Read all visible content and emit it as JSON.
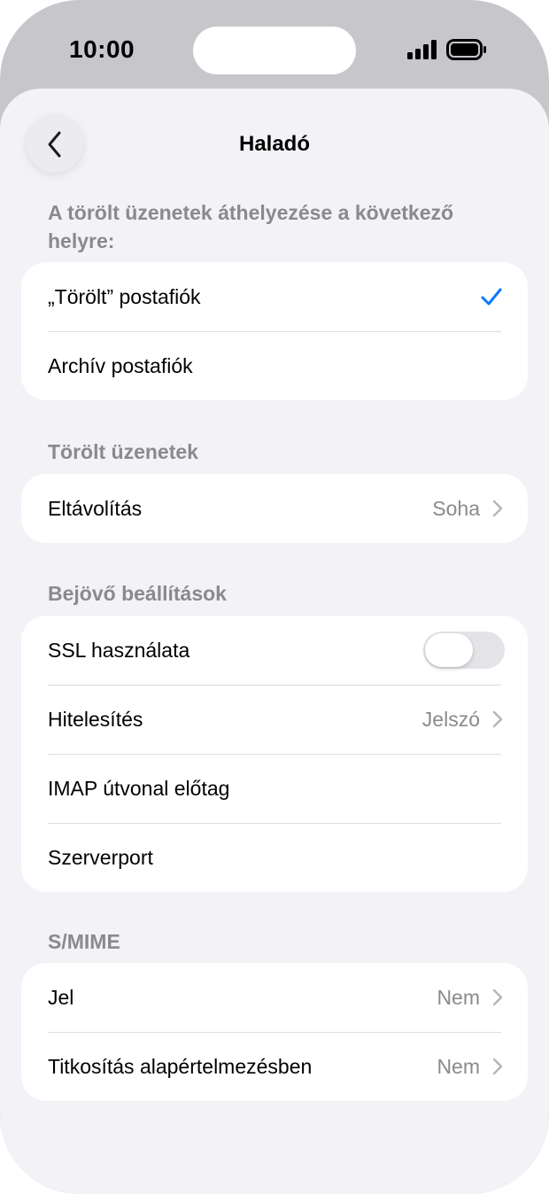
{
  "status_bar": {
    "time": "10:00"
  },
  "nav": {
    "title": "Haladó",
    "back_icon": "chevron-left-icon"
  },
  "move_deleted": {
    "header": "A törölt üzenetek áthelyezése a következő helyre:",
    "items": [
      {
        "label": "„Törölt” postafiók",
        "selected": true
      },
      {
        "label": "Archív postafiók",
        "selected": false
      }
    ]
  },
  "deleted_messages": {
    "header": "Törölt üzenetek",
    "items": [
      {
        "label": "Eltávolítás",
        "value": "Soha"
      }
    ]
  },
  "incoming": {
    "header": "Bejövő beállítások",
    "items": [
      {
        "label": "SSL használata",
        "toggle": false
      },
      {
        "label": "Hitelesítés",
        "value": "Jelszó"
      },
      {
        "label": "IMAP útvonal előtag"
      },
      {
        "label": "Szerverport"
      }
    ]
  },
  "smime": {
    "header": "S/MIME",
    "items": [
      {
        "label": "Jel",
        "value": "Nem"
      },
      {
        "label": "Titkosítás alapértelmezésben",
        "value": "Nem"
      }
    ]
  },
  "colors": {
    "accent": "#0a7aff",
    "secondary_text": "#8a8a8e",
    "background": "#f2f2f7"
  }
}
